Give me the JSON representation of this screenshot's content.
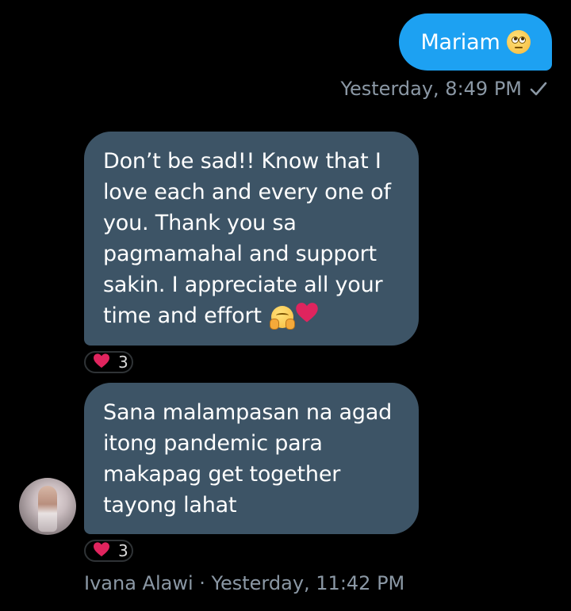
{
  "conversation": {
    "sent_message": {
      "text": "Mariam",
      "emoji": "pleading-face-icon",
      "timestamp": "Yesterday, 8:49 PM",
      "status_icon": "check-icon"
    },
    "received_messages": [
      {
        "lines": [
          "Don’t be sad!! Know that I",
          "love each and every one of",
          "you. Thank you sa",
          "pagmamahal and support",
          "sakin. I appreciate all your",
          "time and effort"
        ],
        "trailing_emojis": [
          "hugging-face-icon",
          "red-heart-icon"
        ],
        "reaction": {
          "icon": "red-heart-icon",
          "count": "3"
        }
      },
      {
        "lines": [
          "Sana malampasan na agad",
          "itong pandemic para",
          "makapag get together",
          "tayong lahat"
        ],
        "reaction": {
          "icon": "red-heart-icon",
          "count": "3"
        }
      }
    ],
    "received_meta": "Ivana Alawi · Yesterday, 11:42 PM"
  },
  "colors": {
    "background": "#000000",
    "sent_bubble": "#1da1f2",
    "received_bubble": "#3d5466",
    "meta_text": "#8b98a5",
    "heart": "#e0245e"
  }
}
